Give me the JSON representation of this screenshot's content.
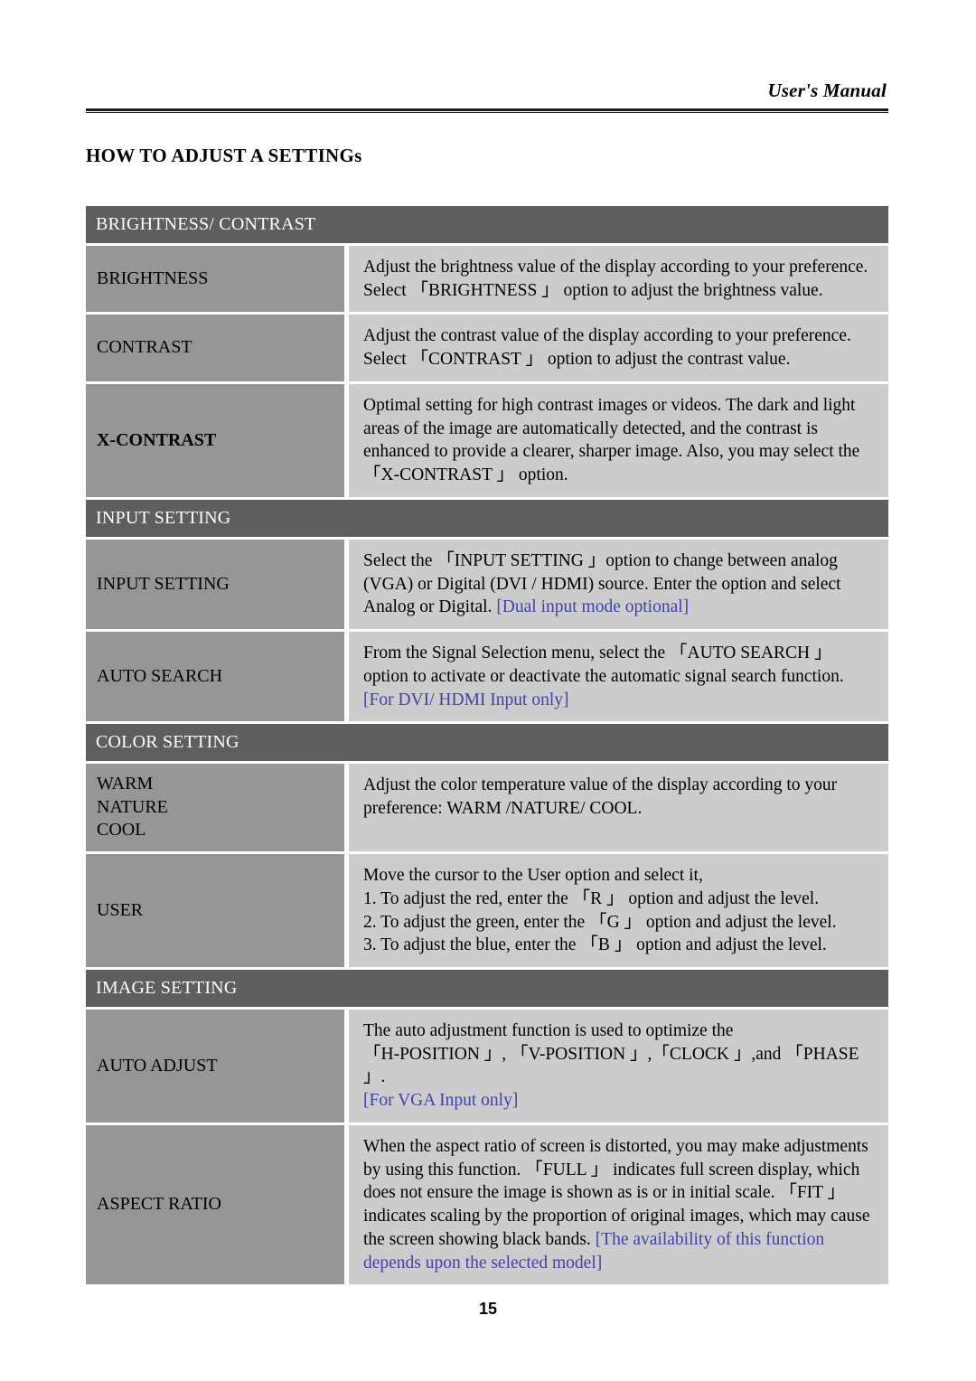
{
  "header": {
    "manual_label": "User's Manual"
  },
  "page_title": "HOW TO ADJUST A SETTINGs",
  "footer": {
    "page_number": "15"
  },
  "colors": {
    "section_header_bg": "#5e5e5e",
    "label_bg": "#969696",
    "description_bg": "#cccccc",
    "note_blue": "#4242a8",
    "page_bg": "#ffffff"
  },
  "sections": [
    {
      "id": "brightness-contrast",
      "header": "BRIGHTNESS/ CONTRAST",
      "rows": [
        {
          "id": "brightness",
          "label": "BRIGHTNESS",
          "label_bold": false,
          "description": "Adjust the brightness value of the display according to your preference. Select 「BRIGHTNESS 」 option to adjust the brightness value."
        },
        {
          "id": "contrast",
          "label": "CONTRAST",
          "label_bold": false,
          "description": "Adjust the contrast value of the display according to your preference. Select 「CONTRAST 」 option to adjust the contrast value."
        },
        {
          "id": "x-contrast",
          "label": "X-CONTRAST",
          "label_bold": true,
          "description": "Optimal setting for high contrast images or videos. The dark and light areas of the image are automatically detected, and the contrast is enhanced to provide a clearer, sharper image. Also, you may select the 「X-CONTRAST 」 option."
        }
      ]
    },
    {
      "id": "input-setting",
      "header": "INPUT SETTING",
      "rows": [
        {
          "id": "input-setting",
          "label": "INPUT SETTING",
          "label_bold": false,
          "description": "Select the 「INPUT SETTING 」option to change between analog (VGA) or Digital (DVI / HDMI) source. Enter the option and select Analog or Digital. ",
          "note": "[Dual input mode optional]"
        },
        {
          "id": "auto-search",
          "label": "AUTO SEARCH",
          "label_bold": false,
          "description": "From the Signal Selection menu, select the 「AUTO SEARCH 」 option to activate or deactivate the automatic signal search function. ",
          "note": "[For DVI/ HDMI Input only]"
        }
      ]
    },
    {
      "id": "color-setting",
      "header": "COLOR SETTING",
      "rows": [
        {
          "id": "warm-nature-cool",
          "label_lines": [
            "WARM",
            "NATURE",
            "COOL"
          ],
          "label_bold": false,
          "description": "Adjust the color temperature value of the display according to your preference: WARM /NATURE/ COOL."
        },
        {
          "id": "user",
          "label": "USER",
          "label_bold": false,
          "desc_lines": [
            "Move the cursor to the User option and select it,",
            "1. To adjust the red, enter the 「R 」 option and adjust the level.",
            "2. To adjust the green, enter the 「G 」 option and adjust the level.",
            "3. To adjust the blue, enter the 「B 」 option and adjust the level."
          ]
        }
      ]
    },
    {
      "id": "image-setting",
      "header": "IMAGE SETTING",
      "rows": [
        {
          "id": "auto-adjust",
          "label": "AUTO ADJUST",
          "label_bold": false,
          "desc_lines": [
            "The auto adjustment function is used to optimize the",
            "「H-POSITION 」, 「V-POSITION 」,「CLOCK 」,and 「PHASE 」."
          ],
          "note": "[For VGA Input only]"
        },
        {
          "id": "aspect-ratio",
          "label": "ASPECT RATIO",
          "label_bold": false,
          "description": "When the aspect ratio of screen is distorted, you may make adjustments by using this function. 「FULL 」 indicates full screen display, which does not ensure the image is shown as is or in initial scale. 「FIT 」indicates scaling by the proportion of original images, which may cause the screen showing black bands. ",
          "note": "[The availability of this function depends upon the selected model]"
        }
      ]
    }
  ]
}
